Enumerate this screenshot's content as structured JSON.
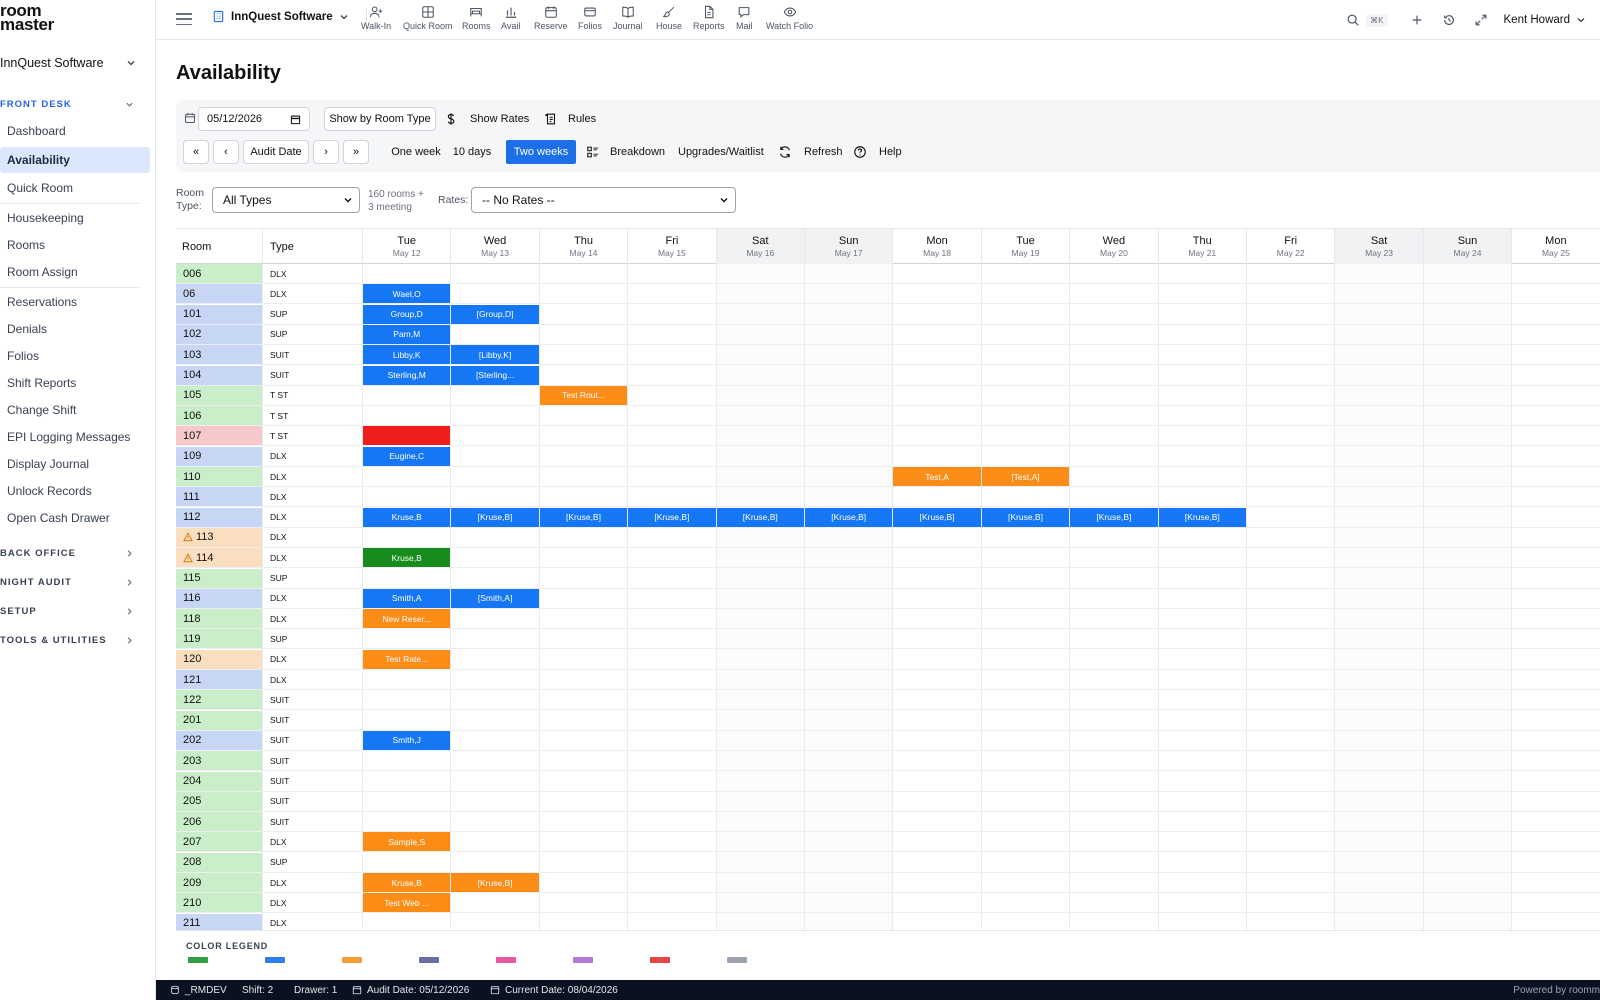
{
  "app": {
    "logo_line1": "room",
    "logo_line2": "master",
    "property": "InnQuest Software"
  },
  "sidebar": {
    "property": "InnQuest Software",
    "sections": {
      "front_desk": "FRONT DESK",
      "back_office": "BACK OFFICE",
      "night_audit": "NIGHT AUDIT",
      "setup": "SETUP",
      "tools": "TOOLS & UTILITIES"
    },
    "items": [
      {
        "label": "Dashboard"
      },
      {
        "label": "Availability"
      },
      {
        "label": "Quick Room"
      },
      {
        "label": "Housekeeping"
      },
      {
        "label": "Rooms"
      },
      {
        "label": "Room Assign"
      },
      {
        "label": "Reservations"
      },
      {
        "label": "Denials"
      },
      {
        "label": "Folios"
      },
      {
        "label": "Shift Reports"
      },
      {
        "label": "Change Shift"
      },
      {
        "label": "EPI Logging Messages"
      },
      {
        "label": "Display Journal"
      },
      {
        "label": "Unlock Records"
      },
      {
        "label": "Open Cash Drawer"
      }
    ]
  },
  "topbar": {
    "tools": [
      {
        "label": "Walk-In",
        "icon": "user-plus-icon"
      },
      {
        "label": "Quick Room",
        "icon": "grid-icon"
      },
      {
        "label": "Rooms",
        "icon": "bed-icon"
      },
      {
        "label": "Avail",
        "icon": "bar-chart-icon"
      },
      {
        "label": "Reserve",
        "icon": "calendar-icon"
      },
      {
        "label": "Folios",
        "icon": "credit-card-icon"
      },
      {
        "label": "Journal",
        "icon": "book-icon"
      },
      {
        "label": "House",
        "icon": "brush-icon"
      },
      {
        "label": "Reports",
        "icon": "file-icon"
      },
      {
        "label": "Mail",
        "icon": "message-icon"
      },
      {
        "label": "Watch Folio",
        "icon": "eye-icon"
      }
    ],
    "shortcut": "⌘K",
    "user": "Kent Howard"
  },
  "page": {
    "title": "Availability"
  },
  "toolbar": {
    "date_value": "05/12/2026",
    "show_by_room_type": "Show by Room Type",
    "show_rates": "Show Rates",
    "rules": "Rules",
    "first": "«",
    "prev": "‹",
    "audit_date": "Audit Date",
    "next": "›",
    "last": "»",
    "one_week": "One week",
    "ten_days": "10 days",
    "two_weeks": "Two weeks",
    "breakdown": "Breakdown",
    "upgrades": "Upgrades/Waitlist",
    "refresh": "Refresh",
    "help": "Help"
  },
  "filters": {
    "room_type_label_1": "Room",
    "room_type_label_2": "Type:",
    "room_type_value": "All Types",
    "count_line1": "160 rooms +",
    "count_line2": "3 meeting",
    "rates_label": "Rates:",
    "rates_value": "-- No Rates --"
  },
  "grid": {
    "col_room": "Room",
    "col_type": "Type",
    "days": [
      {
        "dow": "Tue",
        "date": "May 12",
        "weekend": false
      },
      {
        "dow": "Wed",
        "date": "May 13",
        "weekend": false
      },
      {
        "dow": "Thu",
        "date": "May 14",
        "weekend": false
      },
      {
        "dow": "Fri",
        "date": "May 15",
        "weekend": false
      },
      {
        "dow": "Sat",
        "date": "May 16",
        "weekend": true
      },
      {
        "dow": "Sun",
        "date": "May 17",
        "weekend": true
      },
      {
        "dow": "Mon",
        "date": "May 18",
        "weekend": false
      },
      {
        "dow": "Tue",
        "date": "May 19",
        "weekend": false
      },
      {
        "dow": "Wed",
        "date": "May 20",
        "weekend": false
      },
      {
        "dow": "Thu",
        "date": "May 21",
        "weekend": false
      },
      {
        "dow": "Fri",
        "date": "May 22",
        "weekend": false
      },
      {
        "dow": "Sat",
        "date": "May 23",
        "weekend": true
      },
      {
        "dow": "Sun",
        "date": "May 24",
        "weekend": true
      },
      {
        "dow": "Mon",
        "date": "May 25",
        "weekend": false
      }
    ],
    "rows": [
      {
        "room": "006",
        "type": "DLX",
        "status": "vacant",
        "res": []
      },
      {
        "room": "06",
        "type": "DLX",
        "status": "occupied",
        "res": [
          {
            "day": 0,
            "span": 1,
            "label": "Wael,O",
            "color": "blue"
          }
        ]
      },
      {
        "room": "101",
        "type": "SUP",
        "status": "occupied",
        "res": [
          {
            "day": 0,
            "span": 1,
            "label": "Group,D",
            "color": "blue"
          },
          {
            "day": 1,
            "span": 1,
            "label": "[Group,D]",
            "color": "blue"
          }
        ]
      },
      {
        "room": "102",
        "type": "SUP",
        "status": "occupied",
        "res": [
          {
            "day": 0,
            "span": 1,
            "label": "Pam,M",
            "color": "blue"
          }
        ]
      },
      {
        "room": "103",
        "type": "SUIT",
        "status": "occupied",
        "res": [
          {
            "day": 0,
            "span": 1,
            "label": "Libby,K",
            "color": "blue"
          },
          {
            "day": 1,
            "span": 1,
            "label": "[Libby,K]",
            "color": "blue"
          }
        ]
      },
      {
        "room": "104",
        "type": "SUIT",
        "status": "occupied",
        "res": [
          {
            "day": 0,
            "span": 1,
            "label": "Sterling,M",
            "color": "blue"
          },
          {
            "day": 1,
            "span": 1,
            "label": "[Sterling...",
            "color": "blue"
          }
        ]
      },
      {
        "room": "105",
        "type": "T ST",
        "status": "vacant",
        "res": [
          {
            "day": 2,
            "span": 1,
            "label": "Test Rout...",
            "color": "orange"
          }
        ]
      },
      {
        "room": "106",
        "type": "T ST",
        "status": "vacant",
        "res": []
      },
      {
        "room": "107",
        "type": "T ST",
        "status": "ooo",
        "res": [
          {
            "day": 0,
            "span": 1,
            "label": "",
            "color": "red"
          }
        ]
      },
      {
        "room": "109",
        "type": "DLX",
        "status": "occupied",
        "res": [
          {
            "day": 0,
            "span": 1,
            "label": "Eugine,C",
            "color": "blue"
          }
        ]
      },
      {
        "room": "110",
        "type": "DLX",
        "status": "vacant",
        "res": [
          {
            "day": 6,
            "span": 1,
            "label": "Test,A",
            "color": "orange"
          },
          {
            "day": 7,
            "span": 1,
            "label": "[Test,A]",
            "color": "orange"
          }
        ]
      },
      {
        "room": "111",
        "type": "DLX",
        "status": "occupied",
        "res": []
      },
      {
        "room": "112",
        "type": "DLX",
        "status": "occupied",
        "res": [
          {
            "day": 0,
            "span": 1,
            "label": "Kruse,B",
            "color": "blue"
          },
          {
            "day": 1,
            "span": 1,
            "label": "[Kruse,B]",
            "color": "blue"
          },
          {
            "day": 2,
            "span": 1,
            "label": "[Kruse,B]",
            "color": "blue"
          },
          {
            "day": 3,
            "span": 1,
            "label": "[Kruse,B]",
            "color": "blue"
          },
          {
            "day": 4,
            "span": 1,
            "label": "[Kruse,B]",
            "color": "blue"
          },
          {
            "day": 5,
            "span": 1,
            "label": "[Kruse,B]",
            "color": "blue"
          },
          {
            "day": 6,
            "span": 1,
            "label": "[Kruse,B]",
            "color": "blue"
          },
          {
            "day": 7,
            "span": 1,
            "label": "[Kruse,B]",
            "color": "blue"
          },
          {
            "day": 8,
            "span": 1,
            "label": "[Kruse,B]",
            "color": "blue"
          },
          {
            "day": 9,
            "span": 1,
            "label": "[Kruse,B]",
            "color": "blue"
          }
        ]
      },
      {
        "room": "113",
        "type": "DLX",
        "status": "dirty",
        "warn": true,
        "res": []
      },
      {
        "room": "114",
        "type": "DLX",
        "status": "dirty",
        "warn": true,
        "res": [
          {
            "day": 0,
            "span": 1,
            "label": "Kruse,B",
            "color": "green"
          }
        ]
      },
      {
        "room": "115",
        "type": "SUP",
        "status": "vacant",
        "res": []
      },
      {
        "room": "116",
        "type": "DLX",
        "status": "occupied",
        "res": [
          {
            "day": 0,
            "span": 1,
            "label": "Smith,A",
            "color": "blue"
          },
          {
            "day": 1,
            "span": 1,
            "label": "[Smith,A]",
            "color": "blue"
          }
        ]
      },
      {
        "room": "118",
        "type": "DLX",
        "status": "vacant",
        "res": [
          {
            "day": 0,
            "span": 1,
            "label": "New Reser...",
            "color": "orange"
          }
        ]
      },
      {
        "room": "119",
        "type": "SUP",
        "status": "vacant",
        "res": []
      },
      {
        "room": "120",
        "type": "DLX",
        "status": "dirty",
        "res": [
          {
            "day": 0,
            "span": 1,
            "label": "Test Rate...",
            "color": "orange"
          }
        ]
      },
      {
        "room": "121",
        "type": "DLX",
        "status": "occupied",
        "res": []
      },
      {
        "room": "122",
        "type": "SUIT",
        "status": "vacant",
        "res": []
      },
      {
        "room": "201",
        "type": "SUIT",
        "status": "vacant",
        "res": []
      },
      {
        "room": "202",
        "type": "SUIT",
        "status": "occupied",
        "res": [
          {
            "day": 0,
            "span": 1,
            "label": "Smith,J",
            "color": "blue"
          }
        ]
      },
      {
        "room": "203",
        "type": "SUIT",
        "status": "vacant",
        "res": []
      },
      {
        "room": "204",
        "type": "SUIT",
        "status": "vacant",
        "res": []
      },
      {
        "room": "205",
        "type": "SUIT",
        "status": "vacant",
        "res": []
      },
      {
        "room": "206",
        "type": "SUIT",
        "status": "vacant",
        "res": []
      },
      {
        "room": "207",
        "type": "DLX",
        "status": "vacant",
        "res": [
          {
            "day": 0,
            "span": 1,
            "label": "Sample,S",
            "color": "orange"
          }
        ]
      },
      {
        "room": "208",
        "type": "SUP",
        "status": "vacant",
        "res": []
      },
      {
        "room": "209",
        "type": "DLX",
        "status": "vacant",
        "res": [
          {
            "day": 0,
            "span": 1,
            "label": "Kruse,B",
            "color": "orange"
          },
          {
            "day": 1,
            "span": 1,
            "label": "[Kruse,B]",
            "color": "orange"
          }
        ]
      },
      {
        "room": "210",
        "type": "DLX",
        "status": "vacant",
        "res": [
          {
            "day": 0,
            "span": 1,
            "label": "Test Web ...",
            "color": "orange"
          }
        ]
      },
      {
        "room": "211",
        "type": "DLX",
        "status": "occupied",
        "res": []
      }
    ]
  },
  "legend": {
    "title": "COLOR LEGEND",
    "swatches": [
      "#2f9e44",
      "#2f7fe6",
      "#f59f3a",
      "#6b6fa8",
      "#e8579b",
      "#b07ad6",
      "#e64545",
      "#9ca3af"
    ]
  },
  "statusbar": {
    "db": "_RMDEV",
    "shift": "Shift: 2",
    "drawer": "Drawer: 1",
    "audit_date": "Audit Date: 05/12/2026",
    "current_date": "Current Date: 08/04/2026",
    "powered": "Powered by roomm"
  },
  "colors": {
    "accent": "#1d6fe8",
    "reservation_blue": "#1677f4",
    "reservation_orange": "#fb8c16",
    "out_of_order": "#f01d1d",
    "checked_in": "#178c1c"
  }
}
